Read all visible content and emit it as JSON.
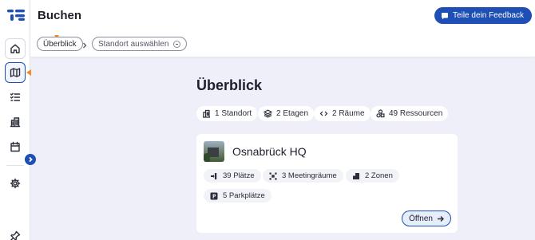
{
  "header": {
    "title": "Buchen",
    "feedback_label": "Teile dein Feedback"
  },
  "breadcrumb": {
    "items": [
      "Überblick",
      "Standort auswählen"
    ]
  },
  "sidebar": {
    "items": [
      {
        "name": "home",
        "icon": "home-icon"
      },
      {
        "name": "map",
        "icon": "map-icon",
        "active": true
      },
      {
        "name": "checklist",
        "icon": "checklist-icon"
      },
      {
        "name": "buildings",
        "icon": "building-icon"
      },
      {
        "name": "calendar",
        "icon": "calendar-icon"
      },
      {
        "name": "settings",
        "icon": "gear-icon"
      },
      {
        "name": "pin",
        "icon": "pin-icon"
      }
    ]
  },
  "main": {
    "title": "Überblick",
    "stats": [
      "1 Standort",
      "2 Etagen",
      "2 Räume",
      "49 Ressourcen"
    ]
  },
  "location": {
    "name": "Osnabrück HQ",
    "features": [
      "39 Plätze",
      "3 Meetingräume",
      "2 Zonen",
      "5 Parkplätze"
    ],
    "open_label": "Öffnen"
  },
  "colors": {
    "accent": "#1e4fb5",
    "marker": "#f08a24",
    "background": "#eeeff8"
  }
}
